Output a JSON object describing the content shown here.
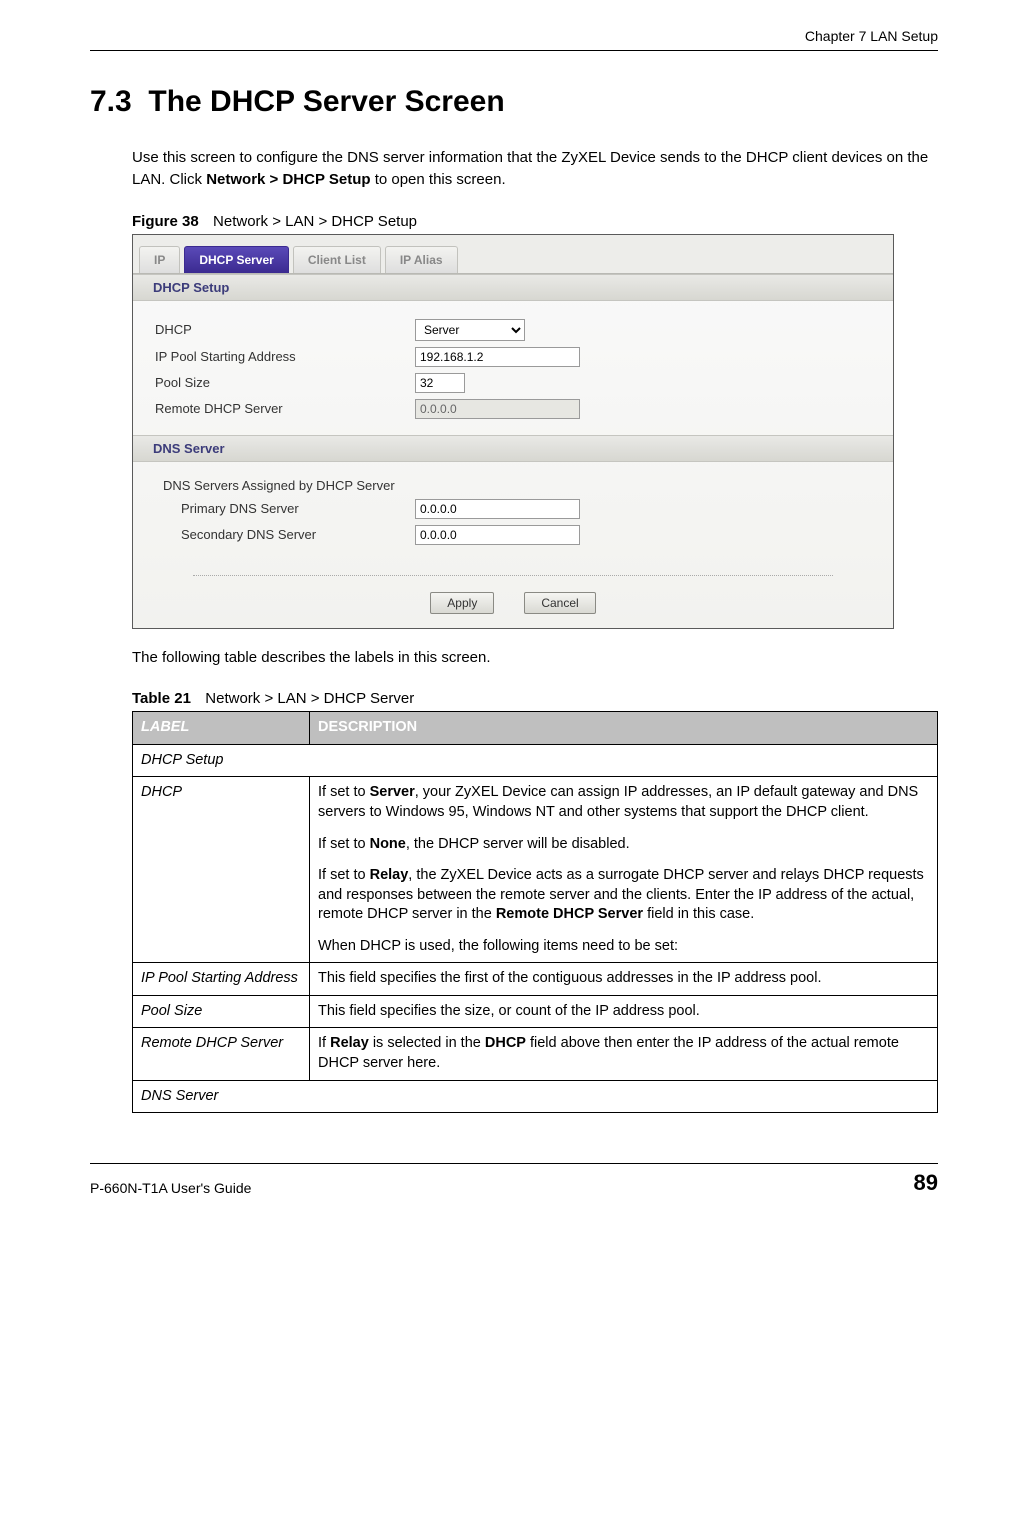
{
  "header": {
    "chapter": "Chapter 7 LAN Setup"
  },
  "section": {
    "number": "7.3",
    "title": "The DHCP Server Screen"
  },
  "intro": {
    "text_before_bold": "Use this screen to configure the DNS server information that the ZyXEL Device sends to the DHCP client devices on the LAN. Click ",
    "bold_path": "Network > DHCP Setup",
    "text_after_bold": " to open this screen."
  },
  "figure": {
    "label": "Figure 38",
    "caption": "Network > LAN > DHCP Setup"
  },
  "screenshot": {
    "tabs": [
      "IP",
      "DHCP Server",
      "Client List",
      "IP Alias"
    ],
    "active_tab_index": 1,
    "panel1_title": "DHCP Setup",
    "rows1": {
      "dhcp_label": "DHCP",
      "dhcp_value": "Server",
      "ip_pool_label": "IP Pool Starting Address",
      "ip_pool_value": "192.168.1.2",
      "pool_size_label": "Pool Size",
      "pool_size_value": "32",
      "remote_label": "Remote DHCP Server",
      "remote_value": "0.0.0.0"
    },
    "panel2_title": "DNS Server",
    "dns_heading": "DNS Servers Assigned by DHCP Server",
    "rows2": {
      "primary_label": "Primary DNS Server",
      "primary_value": "0.0.0.0",
      "secondary_label": "Secondary DNS Server",
      "secondary_value": "0.0.0.0"
    },
    "buttons": {
      "apply": "Apply",
      "cancel": "Cancel"
    }
  },
  "mid_text": "The following table describes the labels in this screen.",
  "table": {
    "label": "Table 21",
    "caption": "Network > LAN > DHCP Server",
    "headers": {
      "label": "LABEL",
      "description": "DESCRIPTION"
    },
    "sections": {
      "dhcp_setup": "DHCP Setup",
      "dns_server": "DNS Server"
    },
    "rows": {
      "dhcp": {
        "label": "DHCP",
        "p1a": "If set to ",
        "p1b": "Server",
        "p1c": ", your ZyXEL Device can assign IP addresses, an IP default gateway and DNS servers to Windows 95, Windows NT and other systems that support the DHCP client.",
        "p2a": "If set to ",
        "p2b": "None",
        "p2c": ", the DHCP server will be disabled.",
        "p3a": "If set to ",
        "p3b": "Relay",
        "p3c": ", the ZyXEL Device acts as a surrogate DHCP server and relays DHCP requests and responses between the remote server and the clients. Enter the IP address of the actual, remote DHCP server in the ",
        "p3d": "Remote DHCP Server",
        "p3e": " field in this case.",
        "p4": "When DHCP is used, the following items need to be set:"
      },
      "ip_pool": {
        "label": "IP Pool Starting Address",
        "desc": "This field specifies the first of the contiguous addresses in the IP address pool."
      },
      "pool_size": {
        "label": "Pool Size",
        "desc": "This field specifies the size, or count of the IP address pool."
      },
      "remote": {
        "label": "Remote DHCP Server",
        "d1": "If ",
        "d2": "Relay",
        "d3": " is selected in the ",
        "d4": "DHCP",
        "d5": " field above then enter the IP address of the actual remote DHCP server here."
      }
    }
  },
  "footer": {
    "guide": "P-660N-T1A User's Guide",
    "page": "89"
  }
}
